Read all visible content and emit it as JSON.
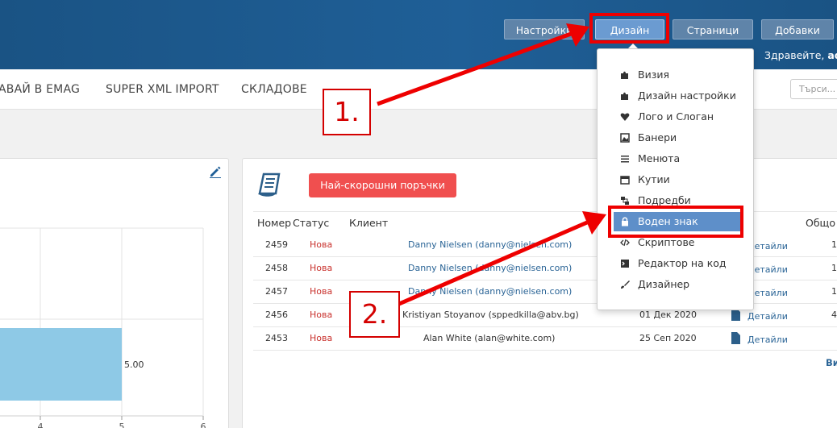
{
  "header": {
    "buttons": [
      "Настройки",
      "Дизайн",
      "Страници",
      "Добавки"
    ],
    "greeting": "Здравейте,",
    "user": "adm"
  },
  "nav": {
    "items": [
      "АВАЙ В EMAG",
      "SUPER XML IMPORT",
      "СКЛАДОВЕ"
    ],
    "search_placeholder": "Търси..."
  },
  "design_menu": {
    "items": [
      {
        "label": "Визия",
        "icon": "puzzle-icon"
      },
      {
        "label": "Дизайн настройки",
        "icon": "puzzle-icon"
      },
      {
        "label": "Лого и Слоган",
        "icon": "heart-icon"
      },
      {
        "label": "Банери",
        "icon": "image-icon"
      },
      {
        "label": "Менюта",
        "icon": "list-icon"
      },
      {
        "label": "Кутии",
        "icon": "box-icon"
      },
      {
        "label": "Подредби",
        "icon": "arrange-icon"
      },
      {
        "label": "Воден знак",
        "icon": "lock-icon",
        "active": true
      },
      {
        "label": "Скриптове",
        "icon": "code-icon"
      },
      {
        "label": "Редактор на код",
        "icon": "terminal-icon"
      },
      {
        "label": "Дизайнер",
        "icon": "brush-icon"
      }
    ]
  },
  "orders": {
    "button": "Най-скорошни поръчки",
    "columns": [
      "Номер",
      "Статус",
      "Клиент",
      "Общо"
    ],
    "rows": [
      {
        "number": "2459",
        "status": "Нова",
        "client": "Danny Nielsen (danny@nielsen.com)",
        "date": "",
        "details": "Детайли",
        "amount": "1"
      },
      {
        "number": "2458",
        "status": "Нова",
        "client": "Danny Nielsen (danny@nielsen.com)",
        "date": "",
        "details": "Детайли",
        "amount": "1"
      },
      {
        "number": "2457",
        "status": "Нова",
        "client": "Danny Nielsen (danny@nielsen.com)",
        "date": "",
        "details": "Детайли",
        "amount": "1"
      },
      {
        "number": "2456",
        "status": "Нова",
        "client": "Kristiyan Stoyanov (sppedkilla@abv.bg)",
        "date": "01 Дек 2020",
        "details": "Детайли",
        "amount": "4"
      },
      {
        "number": "2453",
        "status": "Нова",
        "client": "Alan White (alan@white.com)",
        "date": "25 Сеп 2020",
        "details": "Детайли",
        "amount": ""
      }
    ],
    "view_more": "Ви"
  },
  "chart_data": {
    "type": "bar",
    "orientation": "horizontal",
    "categories": [
      ""
    ],
    "values": [
      5.0
    ],
    "data_labels": [
      "5.00"
    ],
    "x_ticks": [
      "4",
      "5",
      "6"
    ],
    "bar_color": "#8ec9e6",
    "grid": true
  },
  "annotations": {
    "step1": "1.",
    "step2": "2.",
    "color": "#ee0000"
  }
}
